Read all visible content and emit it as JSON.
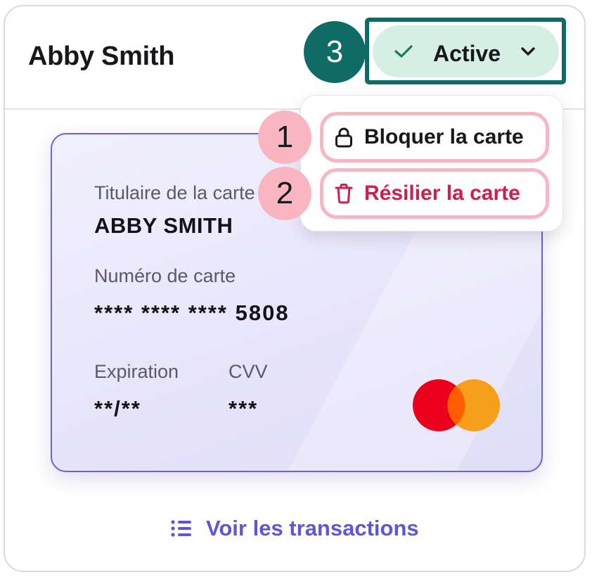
{
  "header": {
    "cardholder_name": "Abby Smith"
  },
  "status": {
    "label": "Active",
    "check_icon": "check-icon",
    "chevron_icon": "chevron-down-icon",
    "background_color": "#d6efe5",
    "highlight_color": "#0f6b66"
  },
  "callouts": {
    "one": "1",
    "two": "2",
    "three": "3"
  },
  "card": {
    "holder_label": "Titulaire de la carte",
    "holder_value": "ABBY SMITH",
    "number_label": "Numéro de carte",
    "number_value": "**** **** **** 5808",
    "expiration_label": "Expiration",
    "expiration_value": "**/**",
    "cvv_label": "CVV",
    "cvv_value": "***",
    "brand_icon": "mastercard-logo",
    "border_color": "#6b62d6"
  },
  "menu": {
    "items": [
      {
        "label": "Bloquer la carte",
        "icon": "lock-icon",
        "color": "#17171c"
      },
      {
        "label": "Résilier la carte",
        "icon": "trash-icon",
        "color": "#d11d4b"
      }
    ]
  },
  "footer": {
    "transactions_label": "Voir les transactions",
    "transactions_icon": "list-icon",
    "link_color": "#5f55d6"
  }
}
